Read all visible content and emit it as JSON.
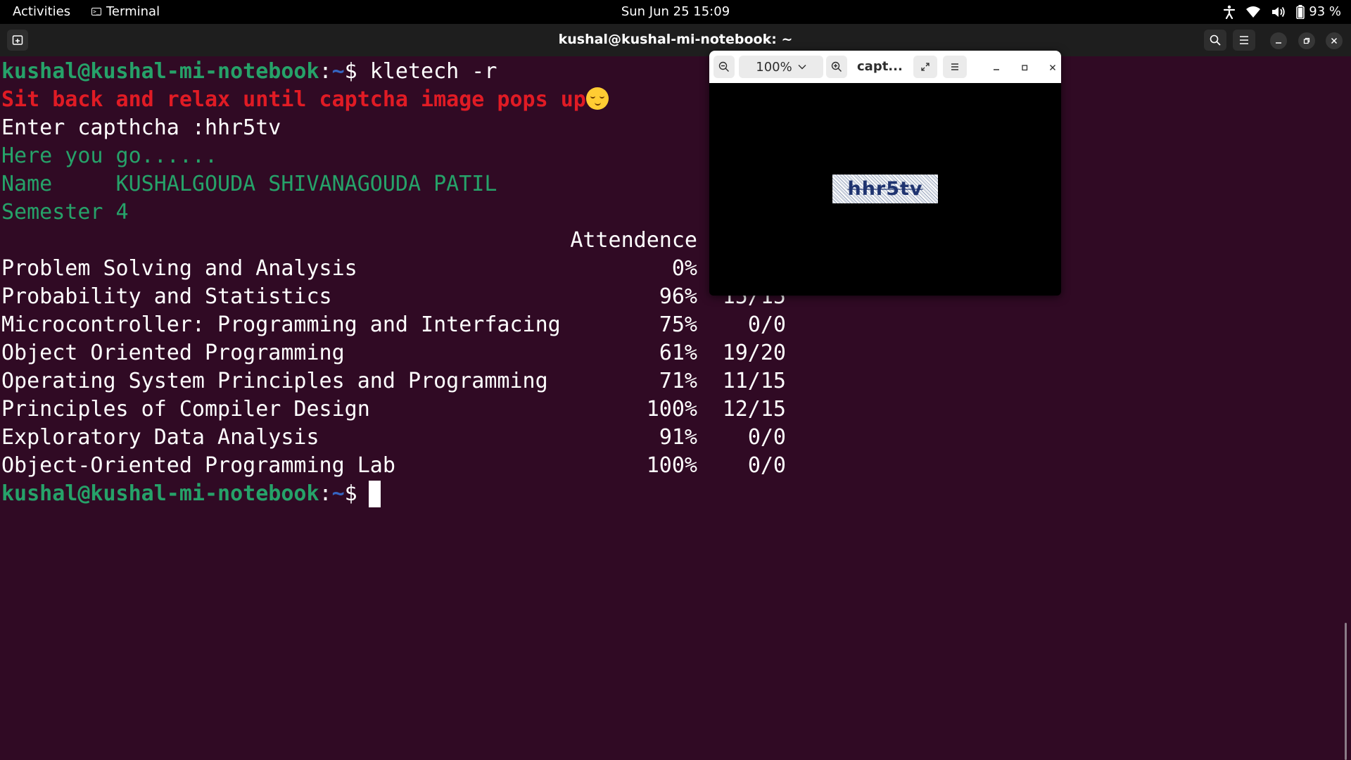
{
  "topbar": {
    "activities": "Activities",
    "app_name": "Terminal",
    "clock": "Sun Jun 25  15:09",
    "battery": "93 %",
    "icons": [
      "accessibility-icon",
      "wifi-icon",
      "volume-icon",
      "battery-icon"
    ]
  },
  "window": {
    "title": "kushal@kushal-mi-notebook: ~"
  },
  "terminal": {
    "prompt_user": "kushal@kushal-mi-notebook",
    "prompt_sep": ":",
    "prompt_path": "~",
    "prompt_sym": "$ ",
    "command": "kletech -r",
    "relax_msg": "Sit back and relax until captcha image pops up",
    "captcha_prompt": "Enter capthcha :",
    "captcha_input": "hhr5tv",
    "here_msg": "Here you go......",
    "name_label": "Name     ",
    "name_value": "KUSHALGOUDA SHIVANAGOUDA PATIL",
    "semester": "Semester 4",
    "attendance_header": "Attendence",
    "rows": [
      {
        "subject": "Problem Solving and Analysis",
        "attendance": "0%",
        "count": ""
      },
      {
        "subject": "Probability and Statistics",
        "attendance": "96%",
        "count": "15/15"
      },
      {
        "subject": "Microcontroller: Programming and Interfacing",
        "attendance": "75%",
        "count": "0/0"
      },
      {
        "subject": "Object Oriented Programming",
        "attendance": "61%",
        "count": "19/20"
      },
      {
        "subject": "Operating System Principles and Programming",
        "attendance": "71%",
        "count": "11/15"
      },
      {
        "subject": "Principles of Compiler Design",
        "attendance": "100%",
        "count": "12/15"
      },
      {
        "subject": "Exploratory Data Analysis",
        "attendance": "91%",
        "count": "0/0"
      },
      {
        "subject": "Object-Oriented Programming Lab",
        "attendance": "100%",
        "count": "0/0"
      }
    ]
  },
  "viewer": {
    "zoom": "100%",
    "title": "capt...",
    "captcha_text": "hhr5tv"
  },
  "colors": {
    "terminal_bg": "#300a24",
    "prompt_green": "#26a269",
    "prompt_blue": "#3565c2",
    "error_red": "#e01b24"
  }
}
